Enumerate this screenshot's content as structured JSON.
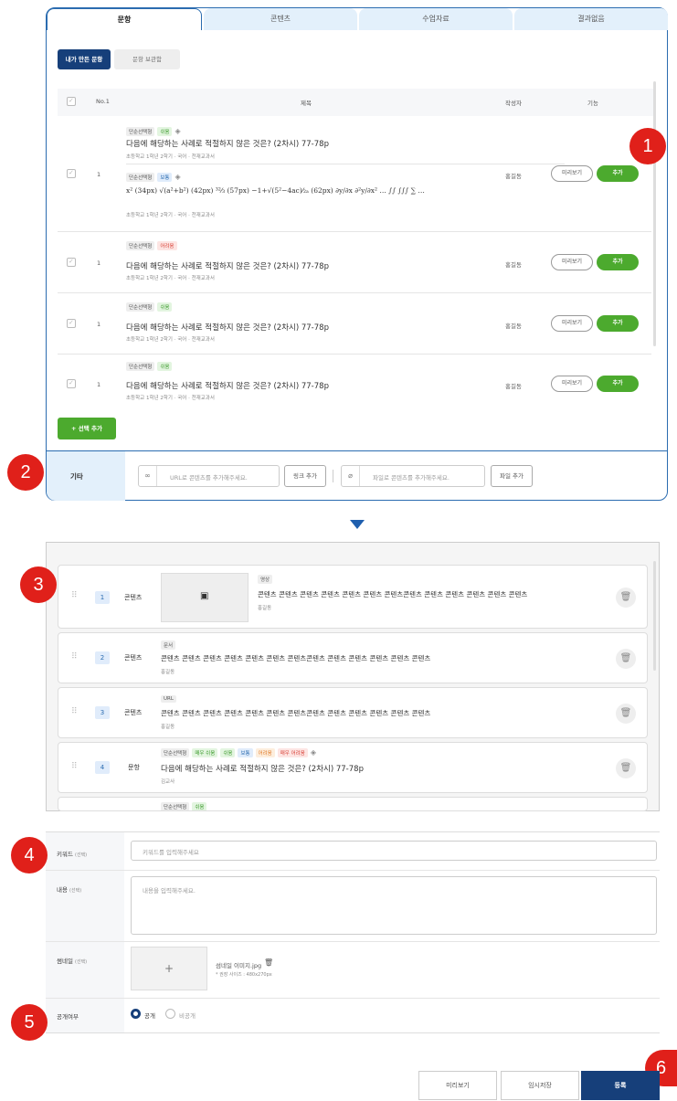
{
  "tabs": [
    "문항",
    "콘텐츠",
    "수업자료",
    "결과없음"
  ],
  "subtabs": {
    "mine": "내가 만든 문항",
    "saved": "문항 보관함"
  },
  "table_head": {
    "no": "No.1",
    "title": "제목",
    "author": "작성자",
    "function": "기능"
  },
  "q_common": {
    "title": "다음에 해당하는 사례로 적절하지 않은 것은? (2차시) 77-78p",
    "sub": "초등학교 1학년 2학기 · 국어 · 천재교과서",
    "author": "홍길동",
    "preview": "미리보기",
    "add": "추가",
    "num": "1"
  },
  "row1": {
    "tag1": "단순선택형",
    "level1": "쉬움",
    "tag2": "단순선택형",
    "level2": "보통",
    "math": "x² (34px) √(a²+b²) (42px) ³²⁄₃ (57px) −1+√(5²−4ac)⁄₂ₐ (62px) ∂y/∂x ∂²y/∂x² … ∫∫ ∫∫∫ ∑ …"
  },
  "row2": {
    "tag": "단순선택형",
    "level": "어려움"
  },
  "row3": {
    "tag": "단순선택형",
    "level": "쉬움"
  },
  "row4": {
    "tag": "단순선택형",
    "level": "쉬움"
  },
  "add_selected": "+ 선택 추가",
  "other": {
    "label": "기타",
    "url_placeholder": "URL로 콘텐츠를 추가해주세요.",
    "link_add": "링크 추가",
    "file_placeholder": "파일로 콘텐츠를 추가해주세요.",
    "file_add": "파일 추가"
  },
  "markers": [
    "1",
    "2",
    "3",
    "4",
    "5",
    "6"
  ],
  "items": [
    {
      "num": "1",
      "type": "콘텐츠",
      "tag": "영상",
      "text": "콘텐츠 콘텐츠 콘텐츠 콘텐츠 콘텐츠 콘텐츠 콘텐츠콘텐츠 콘텐츠 콘텐츠 콘텐츠 콘텐츠 콘텐츠",
      "author": "홍길동"
    },
    {
      "num": "2",
      "type": "콘텐츠",
      "tag": "문서",
      "text": "콘텐츠 콘텐츠 콘텐츠 콘텐츠 콘텐츠 콘텐츠 콘텐츠콘텐츠 콘텐츠 콘텐츠 콘텐츠 콘텐츠 콘텐츠",
      "author": "홍길동"
    },
    {
      "num": "3",
      "type": "콘텐츠",
      "tag": "URL",
      "text": "콘텐츠 콘텐츠 콘텐츠 콘텐츠 콘텐츠 콘텐츠 콘텐츠콘텐츠 콘텐츠 콘텐츠 콘텐츠 콘텐츠 콘텐츠",
      "author": "홍길동"
    },
    {
      "num": "4",
      "type": "문항",
      "text": "다음에 해당하는 사례로 적절하지 않은 것은? (2차시) 77-78p",
      "author": "김교사",
      "tags": [
        "단순선택형",
        "매우 쉬움",
        "쉬움",
        "보통",
        "어려움",
        "매우 어려움"
      ]
    },
    {
      "tag": "단순선택형",
      "level": "쉬움"
    }
  ],
  "form": {
    "keyword_label": "키워드",
    "optional": "(선택)",
    "keyword_placeholder": "키워드를 입력해주세요",
    "content_label": "내용",
    "content_placeholder": "내용을 입력해주세요.",
    "thumb_label": "썸네일",
    "thumb_file": "섬네일 이미지.jpg",
    "thumb_size": "* 권장 사이즈 : 480x270px",
    "public_label": "공개여부",
    "public": "공개",
    "private": "비공개",
    "plus": "+"
  },
  "buttons": {
    "preview": "미리보기",
    "temp_save": "임시저장",
    "register": "등록"
  }
}
